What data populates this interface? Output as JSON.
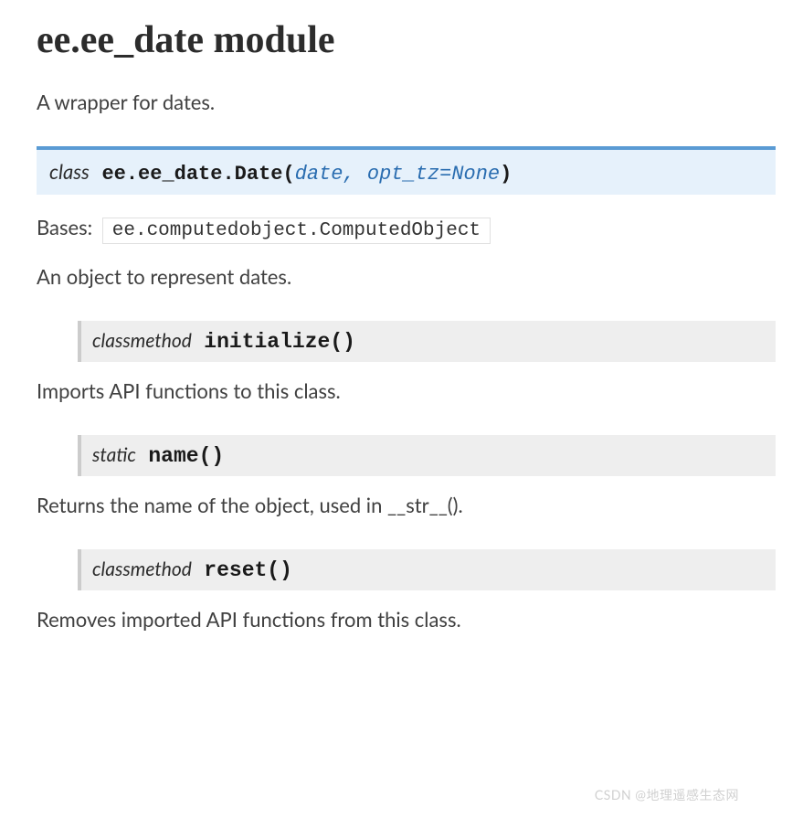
{
  "page": {
    "title": "ee.ee_date module",
    "intro": "A wrapper for dates."
  },
  "class_sig": {
    "keyword": "class",
    "name": "ee.ee_date.Date",
    "paren_open": "(",
    "params": "date, opt_tz=None",
    "paren_close": ")"
  },
  "bases": {
    "label": "Bases:",
    "value": "ee.computedobject.ComputedObject"
  },
  "class_desc": "An object to represent dates.",
  "methods": [
    {
      "keyword": "classmethod",
      "name": "initialize",
      "paren_open": "(",
      "paren_close": ")",
      "desc": "Imports API functions to this class."
    },
    {
      "keyword": "static",
      "name": "name",
      "paren_open": "(",
      "paren_close": ")",
      "desc": "Returns the name of the object, used in __str__()."
    },
    {
      "keyword": "classmethod",
      "name": "reset",
      "paren_open": "(",
      "paren_close": ")",
      "desc": "Removes imported API functions from this class."
    }
  ],
  "watermark": "CSDN @地理遥感生态网"
}
